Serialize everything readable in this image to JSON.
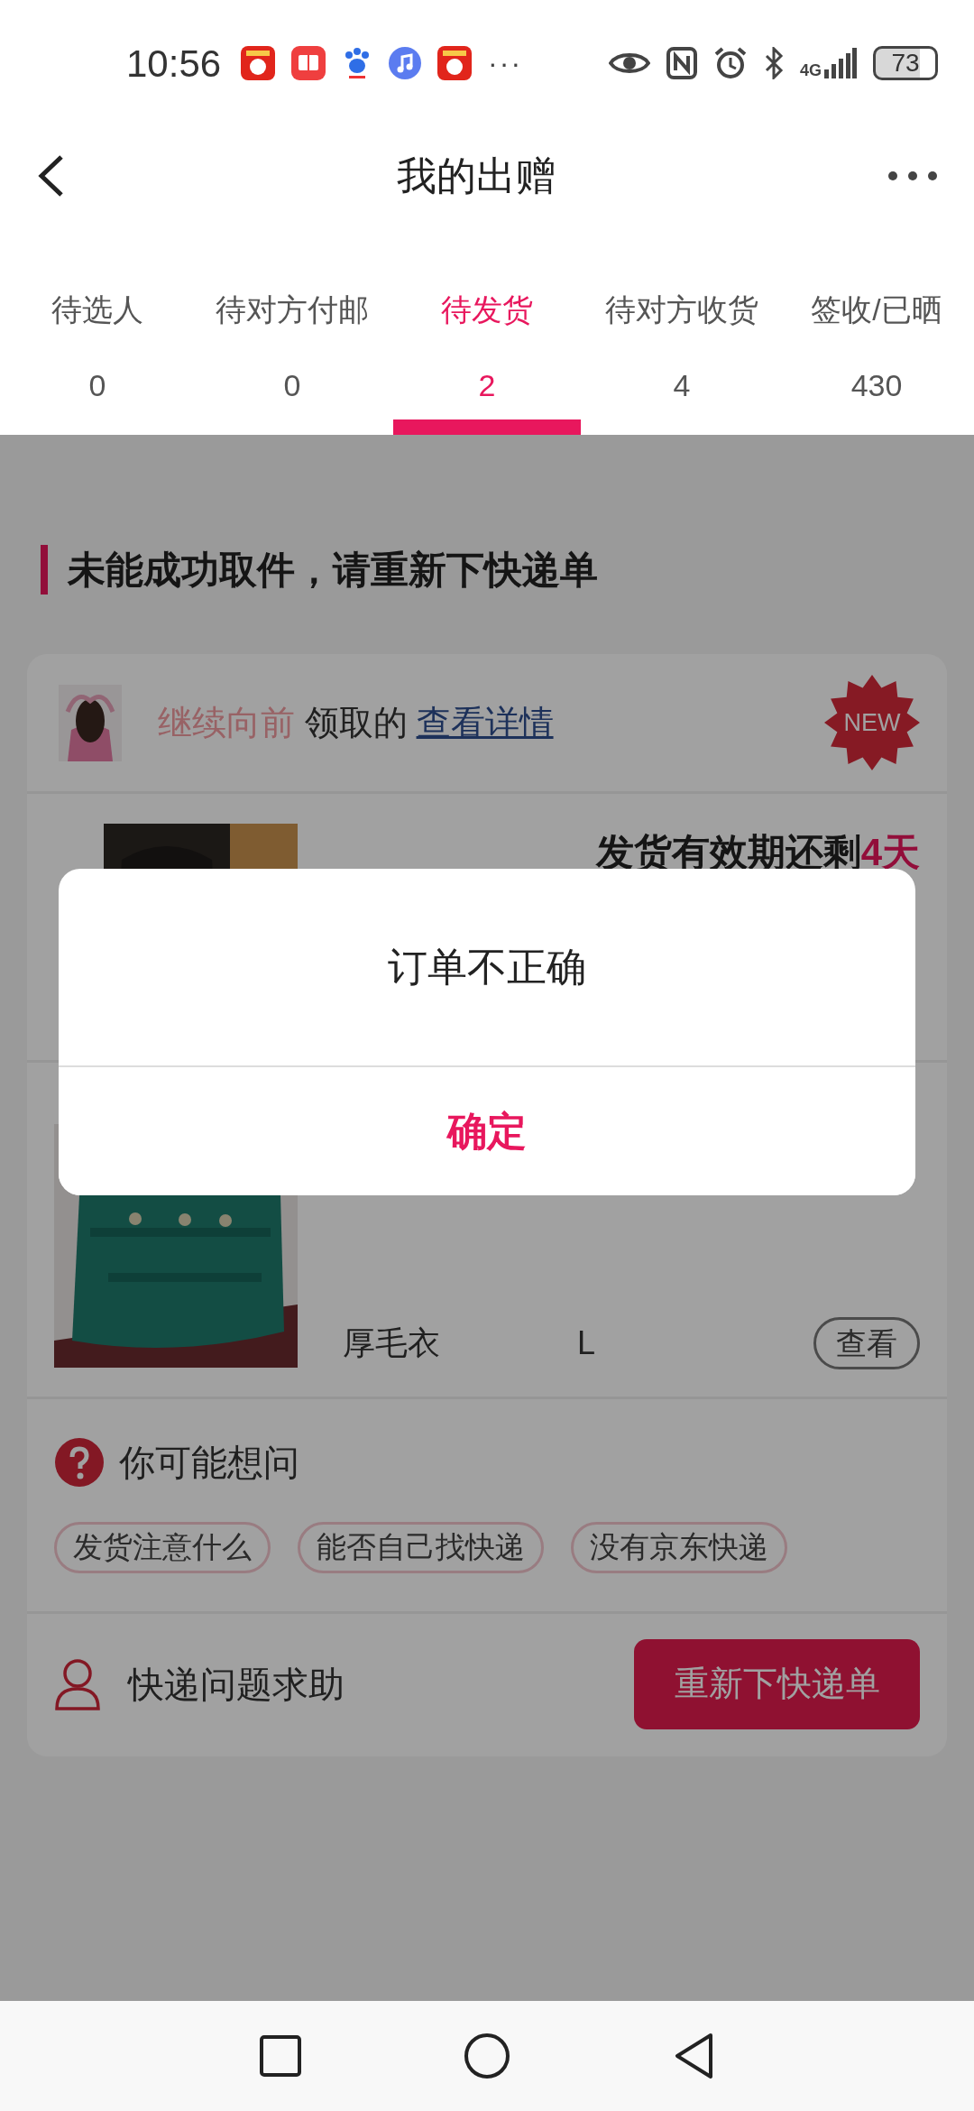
{
  "status_bar": {
    "time": "10:56",
    "more": "···",
    "network": "4G",
    "battery": "73"
  },
  "header": {
    "title": "我的出赠"
  },
  "tabs": [
    {
      "label": "待选人",
      "count": "0",
      "selected": false
    },
    {
      "label": "待对方付邮",
      "count": "0",
      "selected": false
    },
    {
      "label": "待发货",
      "count": "2",
      "selected": true
    },
    {
      "label": "待对方收货",
      "count": "4",
      "selected": false
    },
    {
      "label": "签收/已晒",
      "count": "430",
      "selected": false
    }
  ],
  "section_title": "未能成功取件，请重新下快递单",
  "order": {
    "giver": "继续向前",
    "received_text": "领取的",
    "details_link": "查看详情",
    "badge": "NEW",
    "products": [
      {
        "kind": "deadline",
        "deadline_label": "发货有效期还剩",
        "deadline_days": "4天"
      },
      {
        "kind": "item",
        "name": "厚毛衣",
        "size": "L",
        "view_button": "查看"
      }
    ]
  },
  "faq": {
    "title": "你可能想问",
    "chips": [
      "发货注意什么",
      "能否自己找快递",
      "没有京东快递"
    ]
  },
  "help": {
    "label": "快递问题求助",
    "button": "重新下快递单"
  },
  "dialog": {
    "message": "订单不正确",
    "confirm": "确定"
  }
}
